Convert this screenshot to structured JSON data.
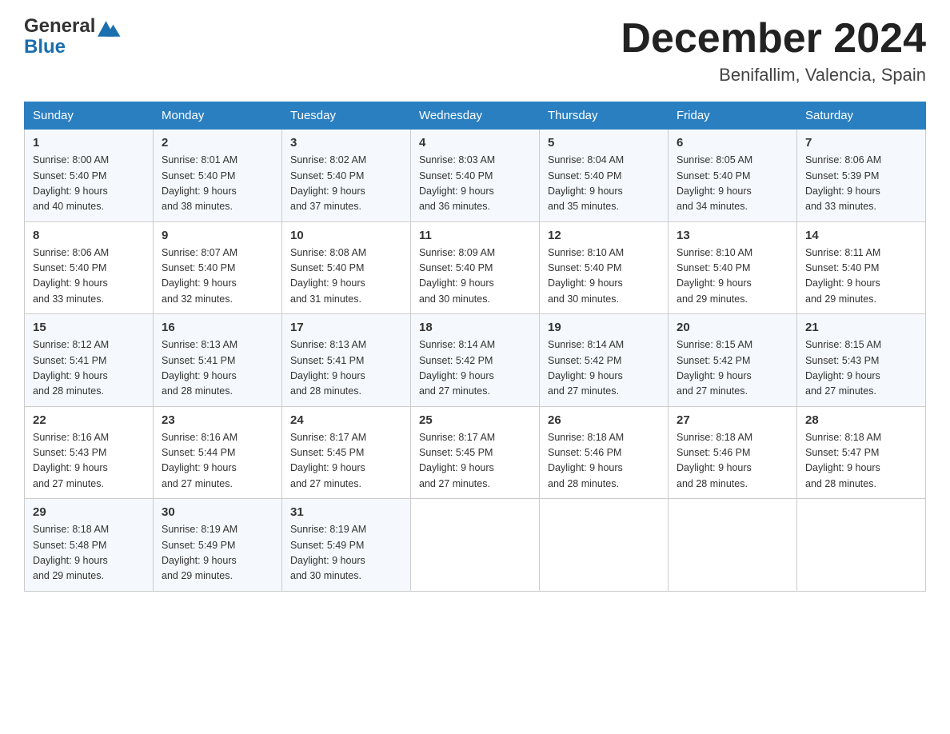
{
  "logo": {
    "text_general": "General",
    "text_blue": "Blue"
  },
  "header": {
    "month_year": "December 2024",
    "location": "Benifallim, Valencia, Spain"
  },
  "days_of_week": [
    "Sunday",
    "Monday",
    "Tuesday",
    "Wednesday",
    "Thursday",
    "Friday",
    "Saturday"
  ],
  "weeks": [
    [
      {
        "day": "1",
        "sunrise": "8:00 AM",
        "sunset": "5:40 PM",
        "daylight": "9 hours and 40 minutes."
      },
      {
        "day": "2",
        "sunrise": "8:01 AM",
        "sunset": "5:40 PM",
        "daylight": "9 hours and 38 minutes."
      },
      {
        "day": "3",
        "sunrise": "8:02 AM",
        "sunset": "5:40 PM",
        "daylight": "9 hours and 37 minutes."
      },
      {
        "day": "4",
        "sunrise": "8:03 AM",
        "sunset": "5:40 PM",
        "daylight": "9 hours and 36 minutes."
      },
      {
        "day": "5",
        "sunrise": "8:04 AM",
        "sunset": "5:40 PM",
        "daylight": "9 hours and 35 minutes."
      },
      {
        "day": "6",
        "sunrise": "8:05 AM",
        "sunset": "5:40 PM",
        "daylight": "9 hours and 34 minutes."
      },
      {
        "day": "7",
        "sunrise": "8:06 AM",
        "sunset": "5:39 PM",
        "daylight": "9 hours and 33 minutes."
      }
    ],
    [
      {
        "day": "8",
        "sunrise": "8:06 AM",
        "sunset": "5:40 PM",
        "daylight": "9 hours and 33 minutes."
      },
      {
        "day": "9",
        "sunrise": "8:07 AM",
        "sunset": "5:40 PM",
        "daylight": "9 hours and 32 minutes."
      },
      {
        "day": "10",
        "sunrise": "8:08 AM",
        "sunset": "5:40 PM",
        "daylight": "9 hours and 31 minutes."
      },
      {
        "day": "11",
        "sunrise": "8:09 AM",
        "sunset": "5:40 PM",
        "daylight": "9 hours and 30 minutes."
      },
      {
        "day": "12",
        "sunrise": "8:10 AM",
        "sunset": "5:40 PM",
        "daylight": "9 hours and 30 minutes."
      },
      {
        "day": "13",
        "sunrise": "8:10 AM",
        "sunset": "5:40 PM",
        "daylight": "9 hours and 29 minutes."
      },
      {
        "day": "14",
        "sunrise": "8:11 AM",
        "sunset": "5:40 PM",
        "daylight": "9 hours and 29 minutes."
      }
    ],
    [
      {
        "day": "15",
        "sunrise": "8:12 AM",
        "sunset": "5:41 PM",
        "daylight": "9 hours and 28 minutes."
      },
      {
        "day": "16",
        "sunrise": "8:13 AM",
        "sunset": "5:41 PM",
        "daylight": "9 hours and 28 minutes."
      },
      {
        "day": "17",
        "sunrise": "8:13 AM",
        "sunset": "5:41 PM",
        "daylight": "9 hours and 28 minutes."
      },
      {
        "day": "18",
        "sunrise": "8:14 AM",
        "sunset": "5:42 PM",
        "daylight": "9 hours and 27 minutes."
      },
      {
        "day": "19",
        "sunrise": "8:14 AM",
        "sunset": "5:42 PM",
        "daylight": "9 hours and 27 minutes."
      },
      {
        "day": "20",
        "sunrise": "8:15 AM",
        "sunset": "5:42 PM",
        "daylight": "9 hours and 27 minutes."
      },
      {
        "day": "21",
        "sunrise": "8:15 AM",
        "sunset": "5:43 PM",
        "daylight": "9 hours and 27 minutes."
      }
    ],
    [
      {
        "day": "22",
        "sunrise": "8:16 AM",
        "sunset": "5:43 PM",
        "daylight": "9 hours and 27 minutes."
      },
      {
        "day": "23",
        "sunrise": "8:16 AM",
        "sunset": "5:44 PM",
        "daylight": "9 hours and 27 minutes."
      },
      {
        "day": "24",
        "sunrise": "8:17 AM",
        "sunset": "5:45 PM",
        "daylight": "9 hours and 27 minutes."
      },
      {
        "day": "25",
        "sunrise": "8:17 AM",
        "sunset": "5:45 PM",
        "daylight": "9 hours and 27 minutes."
      },
      {
        "day": "26",
        "sunrise": "8:18 AM",
        "sunset": "5:46 PM",
        "daylight": "9 hours and 28 minutes."
      },
      {
        "day": "27",
        "sunrise": "8:18 AM",
        "sunset": "5:46 PM",
        "daylight": "9 hours and 28 minutes."
      },
      {
        "day": "28",
        "sunrise": "8:18 AM",
        "sunset": "5:47 PM",
        "daylight": "9 hours and 28 minutes."
      }
    ],
    [
      {
        "day": "29",
        "sunrise": "8:18 AM",
        "sunset": "5:48 PM",
        "daylight": "9 hours and 29 minutes."
      },
      {
        "day": "30",
        "sunrise": "8:19 AM",
        "sunset": "5:49 PM",
        "daylight": "9 hours and 29 minutes."
      },
      {
        "day": "31",
        "sunrise": "8:19 AM",
        "sunset": "5:49 PM",
        "daylight": "9 hours and 30 minutes."
      },
      null,
      null,
      null,
      null
    ]
  ],
  "labels": {
    "sunrise": "Sunrise:",
    "sunset": "Sunset:",
    "daylight": "Daylight:"
  }
}
